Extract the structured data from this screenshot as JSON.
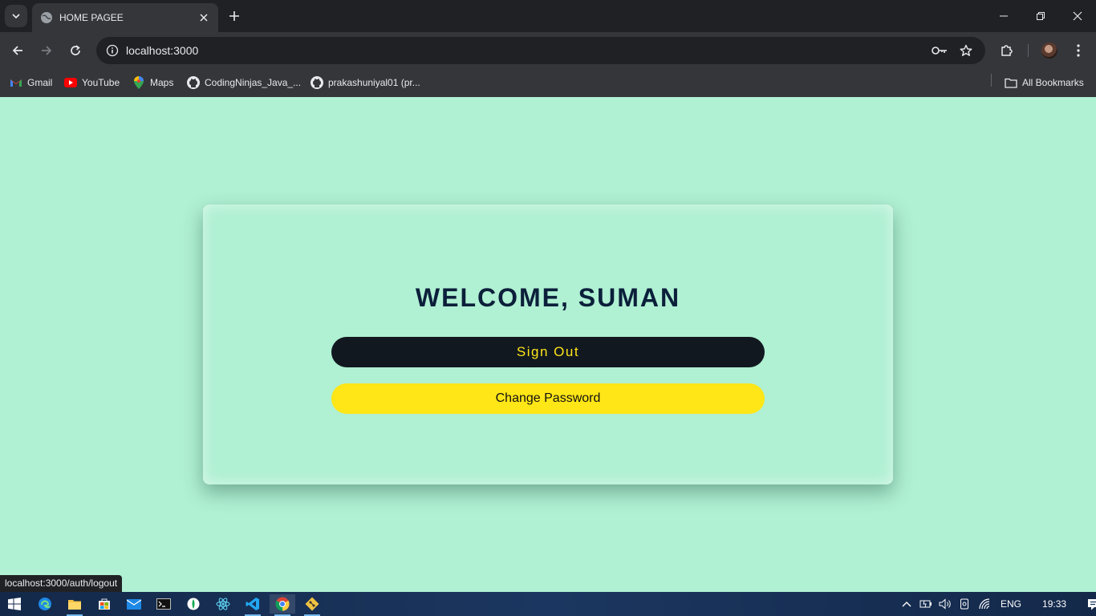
{
  "browser": {
    "tab_title": "HOME PAGEE",
    "url": "localhost:3000",
    "bookmarks": [
      {
        "label": "Gmail",
        "icon": "gmail-icon"
      },
      {
        "label": "YouTube",
        "icon": "youtube-icon"
      },
      {
        "label": "Maps",
        "icon": "maps-icon"
      },
      {
        "label": "CodingNinjas_Java_...",
        "icon": "github-icon"
      },
      {
        "label": "prakashuniyal01 (pr...",
        "icon": "github-icon"
      }
    ],
    "all_bookmarks_label": "All Bookmarks",
    "status_url": "localhost:3000/auth/logout"
  },
  "page": {
    "welcome": "WELCOME, SUMAN",
    "signout_label": "Sign Out",
    "change_password_label": "Change Password"
  },
  "colors": {
    "page_background": "#b0f0d3",
    "heading": "#0b1f3a",
    "signout_bg": "#111820",
    "signout_text": "#ffe51a",
    "change_bg": "#ffe617"
  },
  "taskbar": {
    "apps": [
      "windows-start-icon",
      "edge-icon",
      "file-explorer-icon",
      "store-icon",
      "mail-icon",
      "terminal-icon",
      "mongodb-compass-icon",
      "react-devtools-icon",
      "vscode-icon",
      "chrome-icon",
      "git-icon"
    ],
    "language": "ENG",
    "time": "19:33"
  }
}
